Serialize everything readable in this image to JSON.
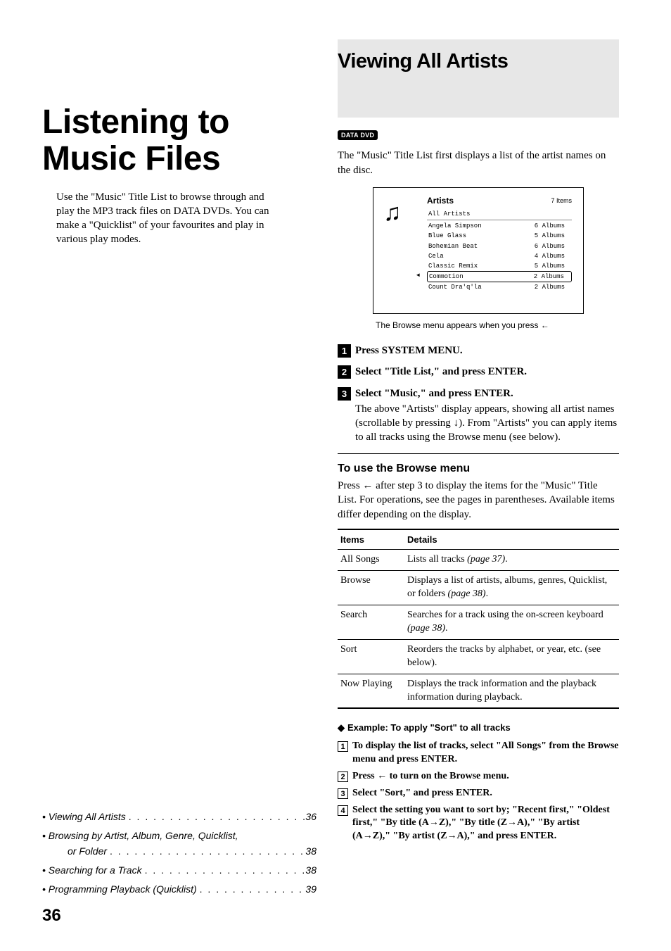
{
  "chapter": {
    "title": "Listening to Music Files",
    "intro": "Use the \"Music\" Title List to browse through and play the MP3 track files on DATA DVDs. You can make a \"Quicklist\" of your favourites and play in various play modes."
  },
  "toc": {
    "items": [
      {
        "label": "Viewing All Artists",
        "page": "36"
      },
      {
        "label": "Browsing by Artist, Album, Genre, Quicklist,",
        "cont": "or Folder",
        "page": "38"
      },
      {
        "label": "Searching for a Track",
        "page": "38"
      },
      {
        "label": "Programming Playback (Quicklist)",
        "page": "39"
      }
    ]
  },
  "section": {
    "title": "Viewing All Artists",
    "badge": "DATA DVD",
    "intro": "The \"Music\" Title List first displays a list of the artist names on the disc."
  },
  "artists_panel": {
    "header": "Artists",
    "count": "7 Items",
    "rows": [
      {
        "name": "All Artists",
        "albums": "",
        "all": true
      },
      {
        "name": "Angela Simpson",
        "albums": "6 Albums"
      },
      {
        "name": "Blue Glass",
        "albums": "5 Albums"
      },
      {
        "name": "Bohemian Beat",
        "albums": "6 Albums"
      },
      {
        "name": "Cela",
        "albums": "4 Albums"
      },
      {
        "name": "Classic Remix",
        "albums": "5 Albums"
      },
      {
        "name": "Commotion",
        "albums": "2 Albums",
        "highlight": true
      },
      {
        "name": "Count Dra'q'la",
        "albums": "2 Albums"
      }
    ],
    "caption_pre": "The Browse menu appears when you press ",
    "caption_arrow": "←"
  },
  "steps": [
    {
      "num": "1",
      "head": "Press SYSTEM MENU."
    },
    {
      "num": "2",
      "head": "Select \"Title List,\" and press ENTER."
    },
    {
      "num": "3",
      "head": "Select \"Music,\" and press ENTER.",
      "desc_pre": "The above \"Artists\" display appears, showing all artist names (scrollable by pressing ",
      "desc_arrow": "↓",
      "desc_post": "). From \"Artists\" you can apply items to all tracks using the Browse menu (see below)."
    }
  ],
  "browse": {
    "heading": "To use the Browse menu",
    "intro_pre": "Press ",
    "intro_arrow": "←",
    "intro_post": " after step 3 to display the items for the \"Music\" Title List. For operations, see the pages in parentheses. Available items differ depending on the display.",
    "th1": "Items",
    "th2": "Details",
    "rows": [
      {
        "item": "All Songs",
        "detail_pre": "Lists all tracks ",
        "detail_ital": "(page 37)",
        "detail_post": "."
      },
      {
        "item": "Browse",
        "detail_pre": "Displays a list of artists, albums, genres, Quicklist, or folders ",
        "detail_ital": "(page 38)",
        "detail_post": "."
      },
      {
        "item": "Search",
        "detail_pre": "Searches for a track using the on-screen keyboard ",
        "detail_ital": "(page 38)",
        "detail_post": "."
      },
      {
        "item": "Sort",
        "detail_pre": "Reorders the tracks by alphabet, or year, etc. (see below).",
        "detail_ital": "",
        "detail_post": ""
      },
      {
        "item": "Now Playing",
        "detail_pre": "Displays the track information and the playback information during playback.",
        "detail_ital": "",
        "detail_post": ""
      }
    ]
  },
  "example": {
    "title": "Example: To apply \"Sort\" to all tracks",
    "steps": [
      {
        "n": "1",
        "t": "To display the list of tracks, select \"All Songs\" from the Browse menu and press ENTER."
      },
      {
        "n": "2",
        "t_pre": "Press ",
        "t_arrow": "←",
        "t_post": " to turn on the Browse menu."
      },
      {
        "n": "3",
        "t": "Select \"Sort,\" and press ENTER."
      },
      {
        "n": "4",
        "t": "Select the setting you want to sort by; \"Recent first,\" \"Oldest first,\" \"By title (A→Z),\" \"By title (Z→A),\" \"By artist (A→Z),\" \"By artist (Z→A),\" and press ENTER."
      }
    ]
  },
  "page_number": "36"
}
